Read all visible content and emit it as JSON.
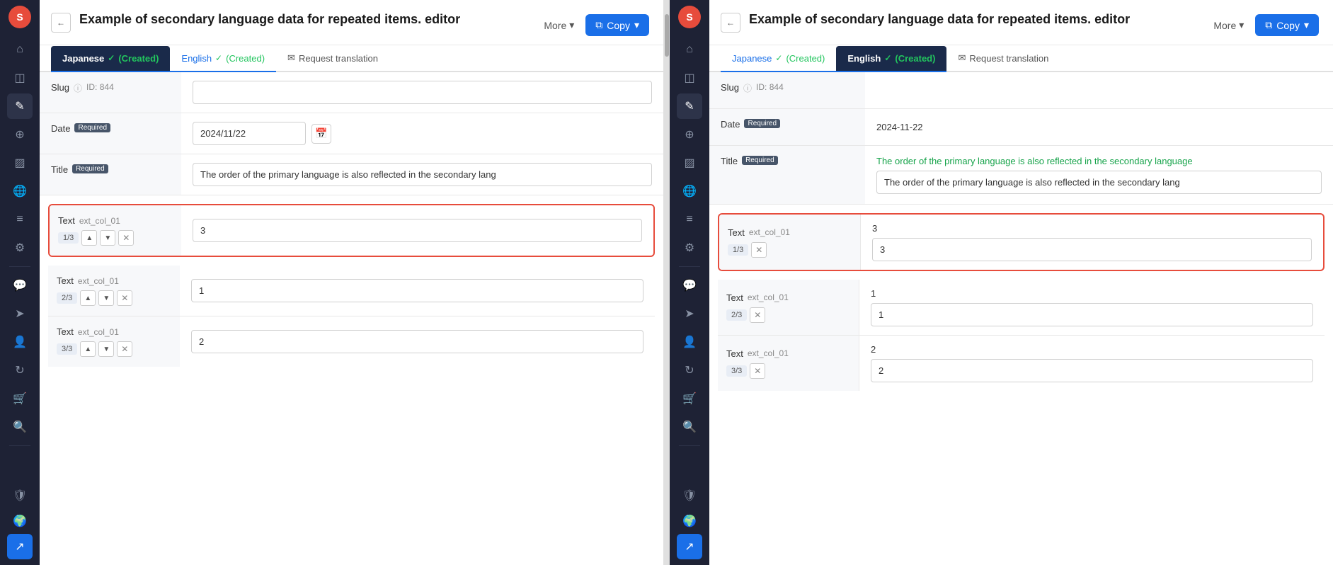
{
  "left_sidebar": {
    "logo": "S",
    "icons": [
      "home",
      "database",
      "pencil",
      "settings",
      "image",
      "globe",
      "layers",
      "gear",
      "chat",
      "send",
      "user",
      "refresh",
      "cart",
      "search",
      "shield",
      "globe2",
      "external-link"
    ]
  },
  "left_panel": {
    "title": "Example of secondary language data for repeated items. editor",
    "back_label": "←",
    "more_label": "More",
    "copy_label": "Copy",
    "tabs": [
      {
        "id": "japanese",
        "label": "Japanese",
        "status": "(Created)",
        "active": true
      },
      {
        "id": "english",
        "label": "English",
        "status": "(Created)",
        "active": false
      }
    ],
    "request_translation_label": "Request translation",
    "fields": {
      "slug": {
        "label": "Slug",
        "id_label": "ID: 844",
        "value": ""
      },
      "date": {
        "label": "Date",
        "required": true,
        "value": "2024/11/22"
      },
      "title": {
        "label": "Title",
        "required": true,
        "value": "The order of the primary language is also reflected in the secondary lang"
      }
    },
    "text_items": [
      {
        "label": "Text",
        "ext": "ext_col_01",
        "counter": "1/3",
        "value": "3",
        "highlighted": true
      },
      {
        "label": "Text",
        "ext": "ext_col_01",
        "counter": "2/3",
        "value": "1",
        "highlighted": false
      },
      {
        "label": "Text",
        "ext": "ext_col_01",
        "counter": "3/3",
        "value": "2",
        "highlighted": false
      }
    ]
  },
  "right_sidebar": {
    "icons": [
      "home",
      "database",
      "pencil",
      "settings",
      "image",
      "globe",
      "layers",
      "gear",
      "chat",
      "send",
      "user",
      "refresh",
      "cart",
      "search",
      "shield",
      "globe2",
      "external-link"
    ]
  },
  "right_panel": {
    "title": "Example of secondary language data for repeated items. editor",
    "more_label": "More",
    "copy_label": "Copy",
    "tabs": [
      {
        "id": "japanese",
        "label": "Japanese",
        "status": "(Created)",
        "active": false
      },
      {
        "id": "english",
        "label": "English",
        "status": "(Created)",
        "active": true
      }
    ],
    "request_translation_label": "Request translation",
    "fields": {
      "slug": {
        "label": "Slug",
        "id_label": "ID: 844",
        "value": ""
      },
      "date": {
        "label": "Date",
        "required": true,
        "value": "2024-11-22"
      },
      "title": {
        "label": "Title",
        "required": true,
        "hint": "The order of the primary language is also reflected in the secondary language",
        "value": "The order of the primary language is also reflected in the secondary lang"
      }
    },
    "text_items": [
      {
        "label": "Text",
        "ext": "ext_col_01",
        "counter": "1/3",
        "value": "3",
        "num_label": "3",
        "highlighted": true
      },
      {
        "label": "Text",
        "ext": "ext_col_01",
        "counter": "2/3",
        "value": "1",
        "num_label": "1",
        "highlighted": false
      },
      {
        "label": "Text",
        "ext": "ext_col_01",
        "counter": "3/3",
        "value": "2",
        "num_label": "2",
        "highlighted": false
      }
    ]
  }
}
